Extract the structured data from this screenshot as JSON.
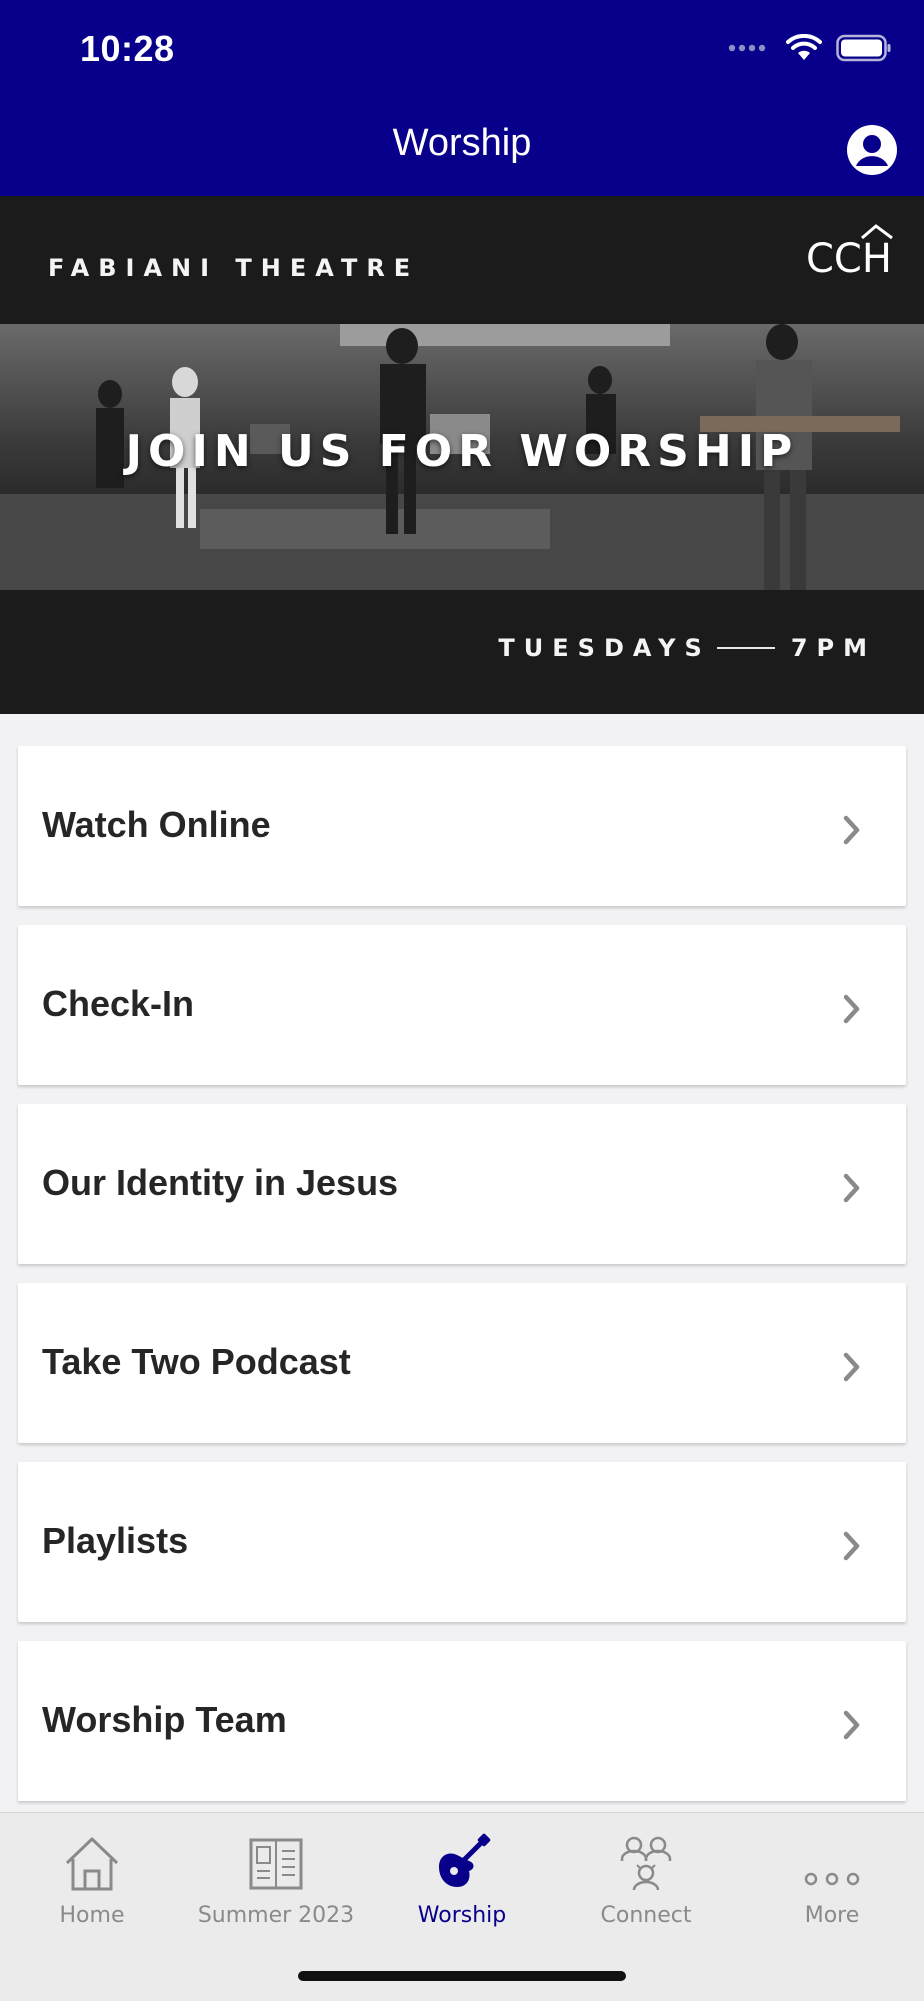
{
  "status_bar": {
    "time": "10:28"
  },
  "nav": {
    "title": "Worship",
    "profile_icon": "profile-icon"
  },
  "banner": {
    "venue": "FABIANI THEATRE",
    "logo_text": "CCH",
    "headline": "JOIN US FOR WORSHIP",
    "schedule_day": "TUESDAYS",
    "schedule_time": "7PM"
  },
  "menu": [
    {
      "label": "Watch Online"
    },
    {
      "label": "Check-In"
    },
    {
      "label": "Our Identity in Jesus"
    },
    {
      "label": "Take Two Podcast"
    },
    {
      "label": "Playlists"
    },
    {
      "label": "Worship Team"
    }
  ],
  "tabs": [
    {
      "label": "Home",
      "icon": "home-icon"
    },
    {
      "label": "Summer 2023",
      "icon": "book-icon"
    },
    {
      "label": "Worship",
      "icon": "guitar-icon",
      "active": true
    },
    {
      "label": "Connect",
      "icon": "people-icon"
    },
    {
      "label": "More",
      "icon": "more-dots-icon"
    }
  ],
  "colors": {
    "brand": "#08008a",
    "tab_inactive": "#8a8a8a",
    "banner_bg": "#1b1b1b"
  }
}
